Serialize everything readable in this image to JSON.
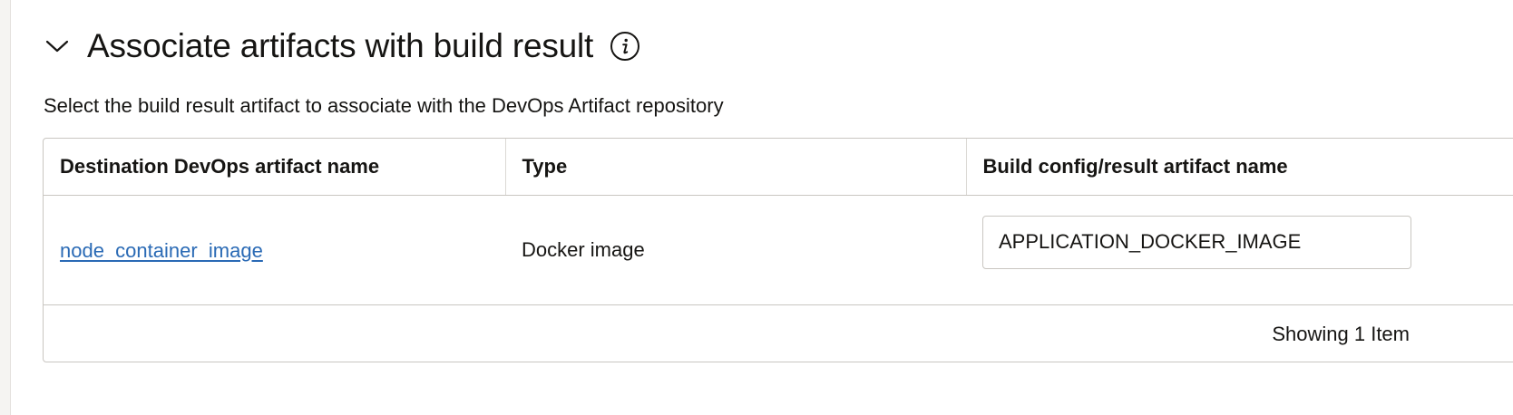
{
  "section": {
    "title": "Associate artifacts with build result",
    "collapse_icon": "chevron-down-icon",
    "info_icon": "info-icon",
    "description": "Select the build result artifact to associate with the DevOps Artifact repository"
  },
  "table": {
    "columns": [
      "Destination DevOps artifact name",
      "Type",
      "Build config/result artifact name"
    ],
    "rows": [
      {
        "artifact_name": "node_container_image",
        "type": "Docker image",
        "result_artifact_name": "APPLICATION_DOCKER_IMAGE"
      }
    ],
    "footer": "Showing 1 Item"
  },
  "colors": {
    "link": "#2a6ab5",
    "text": "#161513",
    "border": "#c9c6c1"
  }
}
